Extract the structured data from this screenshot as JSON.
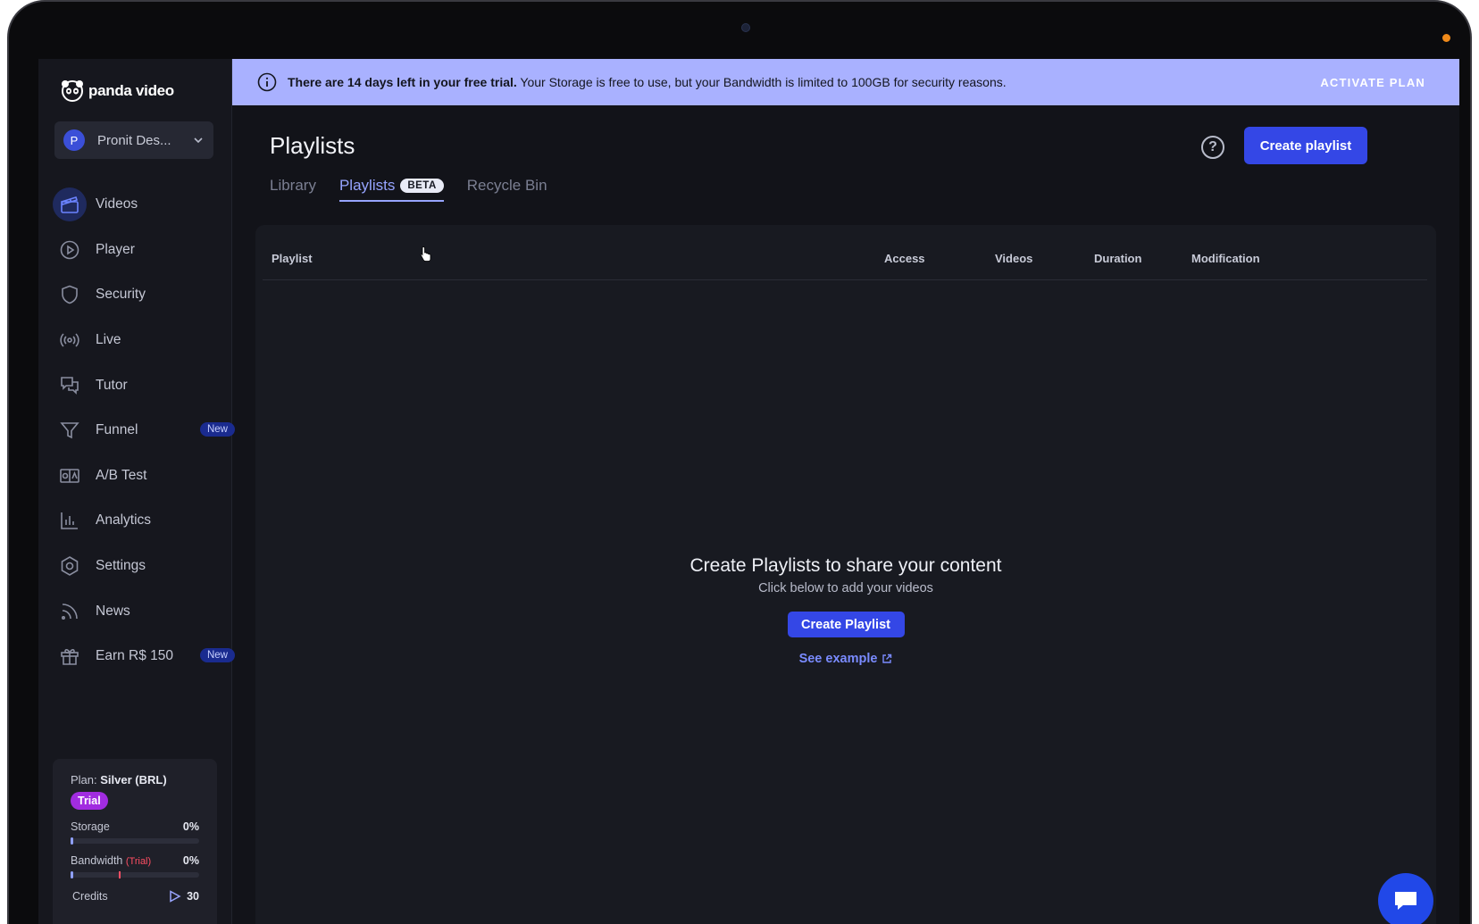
{
  "app": {
    "brand_name": "panda video"
  },
  "account": {
    "initial": "P",
    "name": "Pronit Des..."
  },
  "sidebar": {
    "items": [
      {
        "label": "Videos",
        "icon": "clapperboard-icon",
        "active": true
      },
      {
        "label": "Player",
        "icon": "play-circle-icon"
      },
      {
        "label": "Security",
        "icon": "shield-icon"
      },
      {
        "label": "Live",
        "icon": "broadcast-icon"
      },
      {
        "label": "Tutor",
        "icon": "chat-bubbles-icon"
      },
      {
        "label": "Funnel",
        "icon": "funnel-icon",
        "badge": "New"
      },
      {
        "label": "A/B Test",
        "icon": "ab-test-icon"
      },
      {
        "label": "Analytics",
        "icon": "bar-chart-icon"
      },
      {
        "label": "Settings",
        "icon": "gear-icon"
      },
      {
        "label": "News",
        "icon": "rss-icon"
      },
      {
        "label": "Earn R$ 150",
        "icon": "gift-icon",
        "badge": "New"
      }
    ]
  },
  "plan": {
    "prefix": "Plan:",
    "name": "Silver (BRL)",
    "status": "Trial",
    "storage_label": "Storage",
    "storage_value": "0%",
    "storage_fraction": 0.0,
    "bandwidth_label": "Bandwidth",
    "bandwidth_tag": "(Trial)",
    "bandwidth_value": "0%",
    "bandwidth_fraction": 0.0,
    "credits_label": "Credits",
    "credits_value": "30"
  },
  "banner": {
    "bold": "There are 14 days left in your free trial.",
    "text": " Your Storage is free to use, but your Bandwidth is limited to 100GB for security reasons.",
    "cta": "ACTIVATE PLAN"
  },
  "page": {
    "title": "Playlists",
    "create_button": "Create playlist",
    "help": "?"
  },
  "tabs": [
    {
      "label": "Library"
    },
    {
      "label": "Playlists",
      "badge": "BETA",
      "active": true
    },
    {
      "label": "Recycle Bin"
    }
  ],
  "table": {
    "columns": [
      "Playlist",
      "Access",
      "Videos",
      "Duration",
      "Modification"
    ]
  },
  "empty_state": {
    "title": "Create Playlists to share your content",
    "subtitle": "Click below to add your videos",
    "button": "Create Playlist",
    "link": "See example"
  },
  "colors": {
    "accent": "#3447e6",
    "banner_bg": "#a9b1ff",
    "trial_pill": "#a12ce0",
    "new_badge": "#1a2b8f",
    "background": "#121319"
  }
}
